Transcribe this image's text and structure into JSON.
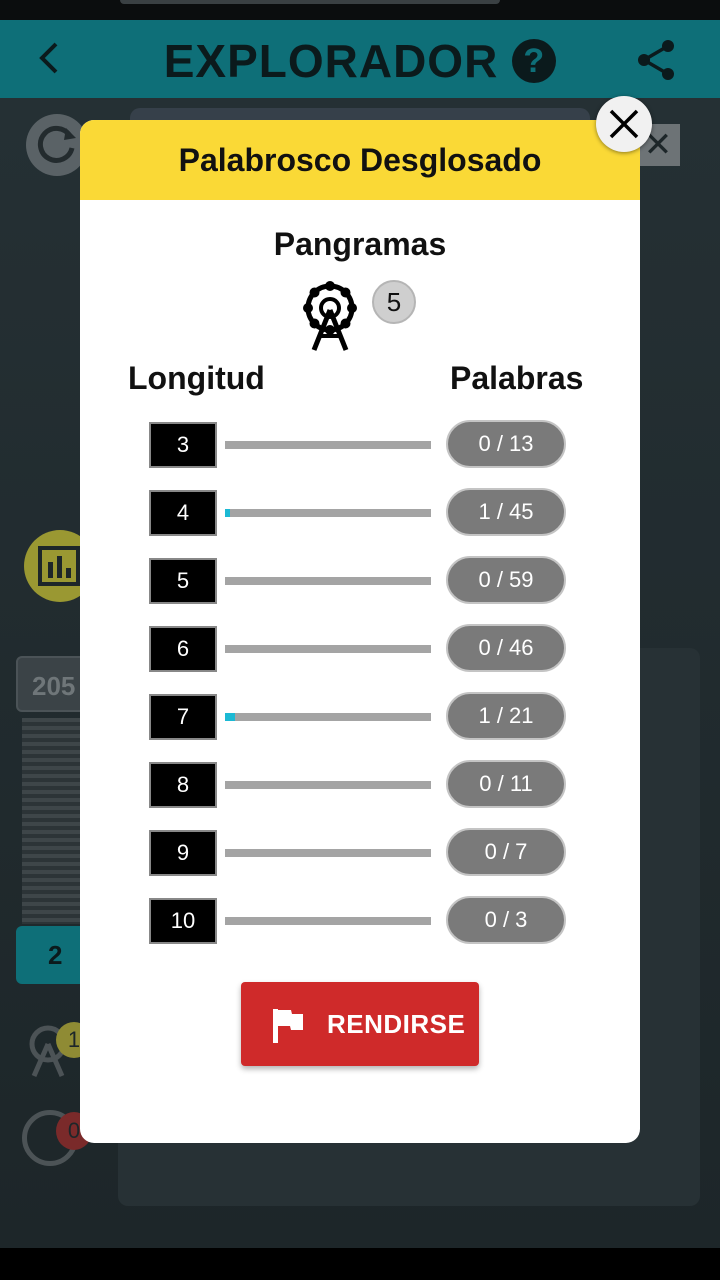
{
  "app": {
    "title": "EXPLORADOR",
    "help_label": "?"
  },
  "background": {
    "close_label": "✕",
    "score_partial": "205",
    "level_label": "2",
    "wheel_badge": "1",
    "alert_badge": "0"
  },
  "modal": {
    "header": "Palabrosco Desglosado",
    "pangrams_title": "Pangramas",
    "pangram_count": "5",
    "col_length": "Longitud",
    "col_words": "Palabras",
    "rows": [
      {
        "length": "3",
        "count": "0 / 13",
        "progress": 0.0
      },
      {
        "length": "4",
        "count": "1 / 45",
        "progress": 0.022
      },
      {
        "length": "5",
        "count": "0 / 59",
        "progress": 0.0
      },
      {
        "length": "6",
        "count": "0 / 46",
        "progress": 0.0
      },
      {
        "length": "7",
        "count": "1 / 21",
        "progress": 0.048
      },
      {
        "length": "8",
        "count": "0 / 11",
        "progress": 0.0
      },
      {
        "length": "9",
        "count": "0 / 7",
        "progress": 0.0
      },
      {
        "length": "10",
        "count": "0 / 3",
        "progress": 0.0
      }
    ],
    "give_up_label": "RENDIRSE"
  },
  "colors": {
    "header_yellow": "#fad936",
    "appbar_teal": "#0e6f78",
    "progress_cyan": "#1bb9d4",
    "button_red": "#cf2a2a",
    "pill_gray": "#7a7a7a"
  },
  "icons": {
    "back": "chevron-left-icon",
    "help": "question-circle-icon",
    "share": "share-icon",
    "close": "close-icon",
    "pangram": "ferris-wheel-icon",
    "give_up": "flag-icon"
  }
}
